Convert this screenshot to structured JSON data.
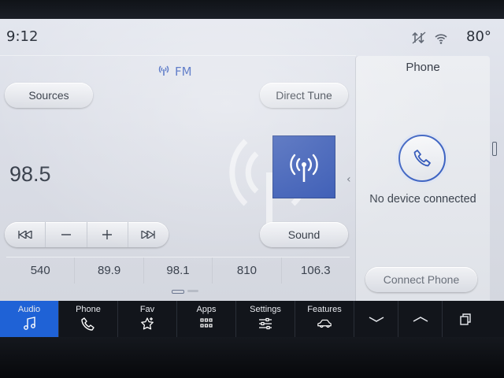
{
  "status": {
    "time": "9:12",
    "temperature": "80°"
  },
  "radio": {
    "band": "FM",
    "frequency": "98.5",
    "sources_label": "Sources",
    "direct_tune_label": "Direct Tune",
    "sound_label": "Sound",
    "presets": [
      "540",
      "89.9",
      "98.1",
      "810",
      "106.3"
    ]
  },
  "phone": {
    "title": "Phone",
    "status": "No device connected",
    "connect_label": "Connect Phone"
  },
  "nav": {
    "items": [
      {
        "label": "Audio",
        "icon": "music-note-icon",
        "active": true
      },
      {
        "label": "Phone",
        "icon": "phone-icon",
        "active": false
      },
      {
        "label": "Fav",
        "icon": "star-plus-icon",
        "active": false
      },
      {
        "label": "Apps",
        "icon": "apps-grid-icon",
        "active": false
      },
      {
        "label": "Settings",
        "icon": "sliders-icon",
        "active": false
      },
      {
        "label": "Features",
        "icon": "car-icon",
        "active": false
      }
    ],
    "arrows": [
      "chevron-down-icon",
      "chevron-up-icon",
      "windows-icon"
    ]
  },
  "colors": {
    "accent": "#1f62d6",
    "art_bg": "#2d50b0",
    "band_text": "#2f55b8"
  }
}
